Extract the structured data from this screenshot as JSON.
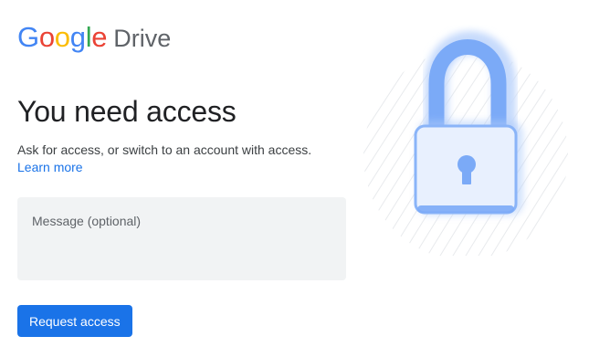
{
  "header": {
    "logo_letters": [
      {
        "char": "G",
        "color": "#4285F4"
      },
      {
        "char": "o",
        "color": "#EA4335"
      },
      {
        "char": "o",
        "color": "#FBBC05"
      },
      {
        "char": "g",
        "color": "#4285F4"
      },
      {
        "char": "l",
        "color": "#34A853"
      },
      {
        "char": "e",
        "color": "#EA4335"
      }
    ],
    "product_name": "Drive"
  },
  "main": {
    "title": "You need access",
    "subtitle": "Ask for access, or switch to an account with access.",
    "learn_more": "Learn more",
    "message": {
      "placeholder": "Message (optional)",
      "value": ""
    },
    "request_button": "Request access"
  },
  "illustration": {
    "icon": "padlock-icon",
    "colors": {
      "shackle": "#7BAAF7",
      "body_fill": "#E8F0FE",
      "body_border": "#8AB4F8",
      "keyhole": "#7BAAF7",
      "glow": "#AECBFA",
      "hatch_lines": "#E8EAED"
    }
  },
  "colors": {
    "accent": "#1A73E8",
    "text_primary": "#202124",
    "text_secondary": "#3C4043",
    "field_background": "#F1F3F4"
  }
}
